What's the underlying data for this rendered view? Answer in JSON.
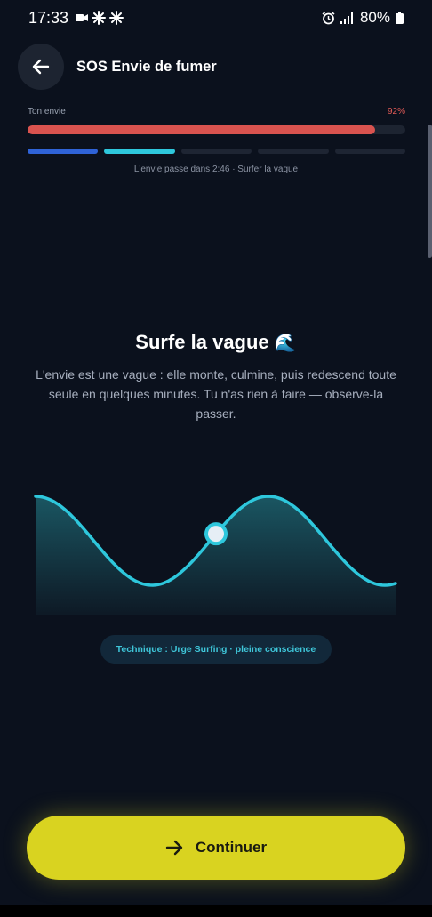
{
  "status_bar": {
    "time": "17:33",
    "battery": "80%",
    "icons": [
      "video-camera-icon",
      "pinwheel-icon",
      "pinwheel-icon",
      "alarm-icon",
      "signal-icon",
      "battery-icon"
    ]
  },
  "header": {
    "back_icon": "arrow-left-icon",
    "title": "SOS Envie de fumer"
  },
  "craving": {
    "label": "Ton envie",
    "percent_text": "92%",
    "level": 0.92
  },
  "steps": {
    "total": 5,
    "done": 1,
    "current": 2,
    "colors": {
      "done": "#2f63d7",
      "current": "#2ec7dc",
      "pending": "#1e2533"
    }
  },
  "timer_text": "L'envie passe dans 2:46 · Surfer la vague",
  "main": {
    "title": "Surfe la vague",
    "title_emoji": "🌊",
    "description": "L'envie est une vague : elle monte, culmine, puis redescend toute seule en quelques minutes. Tu n'as rien à faire — observe-la passer."
  },
  "wave": {
    "stroke_color": "#2ec7dc",
    "progress": 0.5
  },
  "technique_badge": "Technique : Urge Surfing · pleine conscience",
  "continue_button": {
    "label": "Continuer",
    "icon": "arrow-right-icon",
    "color": "#d9d320"
  }
}
